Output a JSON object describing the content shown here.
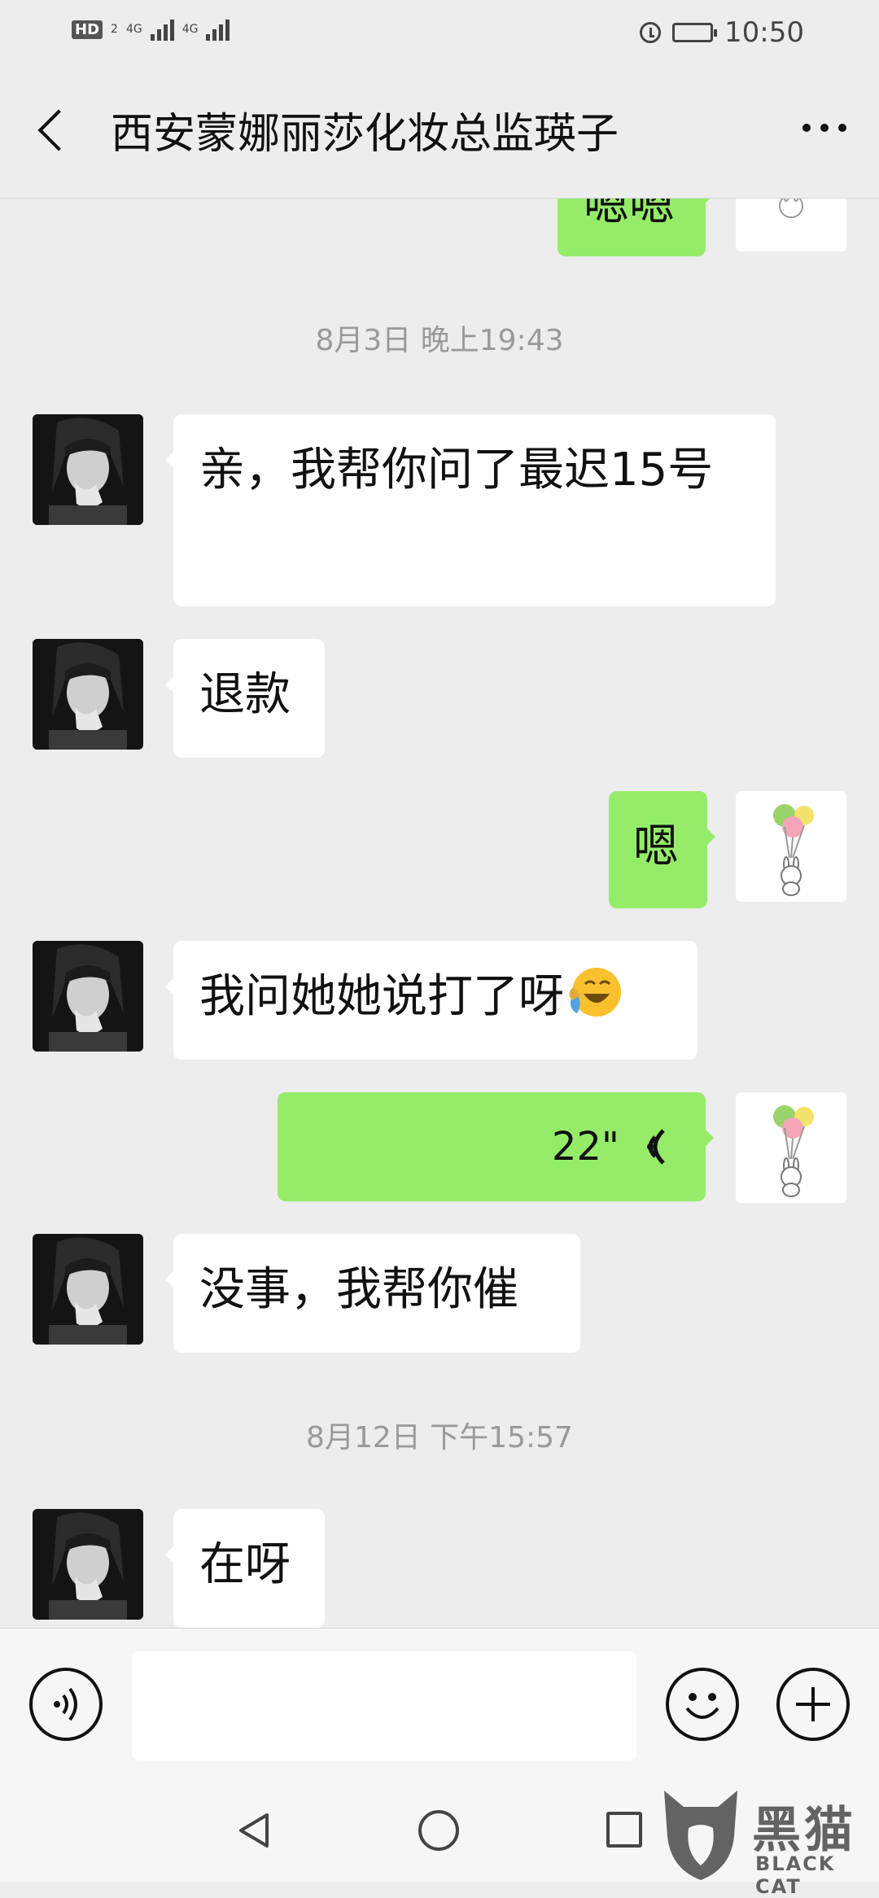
{
  "status_bar": {
    "hd_label": "HD",
    "sim2_label": "2",
    "net1": "4G",
    "net2": "4G",
    "time": "10:50"
  },
  "header": {
    "title": "西安蒙娜丽莎化妆总监瑛子"
  },
  "messages": [
    {
      "side": "out",
      "type": "text",
      "text": "嗯嗯"
    },
    {
      "type": "timestamp",
      "text": "8月3日 晚上19:43"
    },
    {
      "side": "in",
      "type": "text",
      "text": "亲，我帮你问了最迟15号"
    },
    {
      "side": "in",
      "type": "text",
      "text": "退款"
    },
    {
      "side": "out",
      "type": "text",
      "text": "嗯"
    },
    {
      "side": "in",
      "type": "text",
      "text": "我问她她说打了呀",
      "emoji": "face-with-tears-of-joy-emoji"
    },
    {
      "side": "out",
      "type": "voice",
      "duration": "22\""
    },
    {
      "side": "in",
      "type": "text",
      "text": "没事，我帮你催"
    },
    {
      "type": "timestamp",
      "text": "8月12日 下午15:57"
    },
    {
      "side": "in",
      "type": "text",
      "text": "在呀"
    }
  ],
  "input_bar": {
    "placeholder": ""
  },
  "watermark": {
    "brand": "黑猫",
    "brand_en": "BLACK CAT"
  },
  "colors": {
    "background": "#ededed",
    "outgoing_bubble": "#95ec69",
    "incoming_bubble": "#ffffff",
    "timestamp_text": "#999999"
  },
  "icons": [
    "back-icon",
    "more-icon",
    "voice-input-icon",
    "emoji-icon",
    "plus-icon",
    "nav-back-icon",
    "nav-home-icon",
    "nav-recent-icon",
    "alarm-icon",
    "battery-icon",
    "signal-icon"
  ]
}
